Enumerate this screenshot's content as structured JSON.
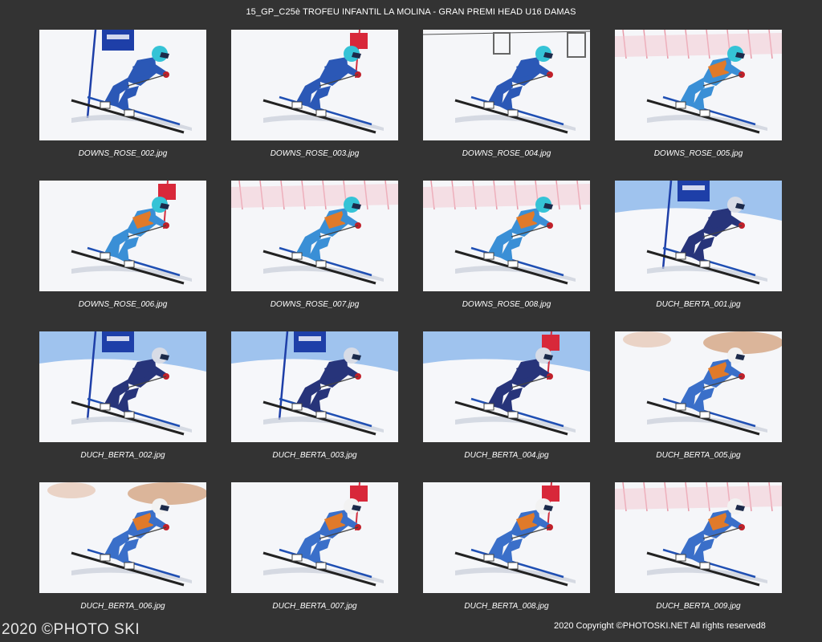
{
  "page": {
    "title": "15_GP_C25è TROFEU INFANTIL LA MOLINA - GRAN PREMI HEAD U16 DAMAS",
    "watermark": "2020 ©PHOTO SKI",
    "copyright": "2020 Copyright ©PHOTOSKI.NET All rights reserved",
    "page_number": "8"
  },
  "photos": [
    {
      "file": "DOWNS_ROSE_002.jpg",
      "suit": "#2b58b6",
      "helmet": "#35c3d6",
      "bib": "#2b58b6",
      "bg": "flag-blue",
      "sky": false
    },
    {
      "file": "DOWNS_ROSE_003.jpg",
      "suit": "#2b58b6",
      "helmet": "#35c3d6",
      "bib": "#2b58b6",
      "bg": "flag-red",
      "sky": false
    },
    {
      "file": "DOWNS_ROSE_004.jpg",
      "suit": "#2b58b6",
      "helmet": "#35c3d6",
      "bib": "#2b58b6",
      "bg": "lift",
      "sky": false
    },
    {
      "file": "DOWNS_ROSE_005.jpg",
      "suit": "#3a8fd6",
      "helmet": "#35c3d6",
      "bib": "#e07a2a",
      "bg": "fence",
      "sky": false
    },
    {
      "file": "DOWNS_ROSE_006.jpg",
      "suit": "#3a8fd6",
      "helmet": "#35c3d6",
      "bib": "#e07a2a",
      "bg": "flag-red",
      "sky": false
    },
    {
      "file": "DOWNS_ROSE_007.jpg",
      "suit": "#3a8fd6",
      "helmet": "#35c3d6",
      "bib": "#e07a2a",
      "bg": "fence",
      "sky": false
    },
    {
      "file": "DOWNS_ROSE_008.jpg",
      "suit": "#3a8fd6",
      "helmet": "#35c3d6",
      "bib": "#e07a2a",
      "bg": "fence",
      "sky": false
    },
    {
      "file": "DUCH_BERTA_001.jpg",
      "suit": "#27347a",
      "helmet": "#d8dce6",
      "bib": "#27347a",
      "bg": "flag-blue",
      "sky": true
    },
    {
      "file": "DUCH_BERTA_002.jpg",
      "suit": "#27347a",
      "helmet": "#d8dce6",
      "bib": "#27347a",
      "bg": "flag-blue",
      "sky": true
    },
    {
      "file": "DUCH_BERTA_003.jpg",
      "suit": "#27347a",
      "helmet": "#d8dce6",
      "bib": "#27347a",
      "bg": "flag-blue",
      "sky": true
    },
    {
      "file": "DUCH_BERTA_004.jpg",
      "suit": "#27347a",
      "helmet": "#d8dce6",
      "bib": "#27347a",
      "bg": "flag-red",
      "sky": true
    },
    {
      "file": "DUCH_BERTA_005.jpg",
      "suit": "#3a6fc9",
      "helmet": "#f2f2f2",
      "bib": "#e07a2a",
      "bg": "trees",
      "sky": false
    },
    {
      "file": "DUCH_BERTA_006.jpg",
      "suit": "#3a6fc9",
      "helmet": "#f2f2f2",
      "bib": "#e07a2a",
      "bg": "trees",
      "sky": false
    },
    {
      "file": "DUCH_BERTA_007.jpg",
      "suit": "#3a6fc9",
      "helmet": "#f2f2f2",
      "bib": "#e07a2a",
      "bg": "flag-red",
      "sky": false
    },
    {
      "file": "DUCH_BERTA_008.jpg",
      "suit": "#3a6fc9",
      "helmet": "#f2f2f2",
      "bib": "#e07a2a",
      "bg": "flag-red",
      "sky": false
    },
    {
      "file": "DUCH_BERTA_009.jpg",
      "suit": "#3a6fc9",
      "helmet": "#f2f2f2",
      "bib": "#e07a2a",
      "bg": "fence",
      "sky": false
    }
  ]
}
